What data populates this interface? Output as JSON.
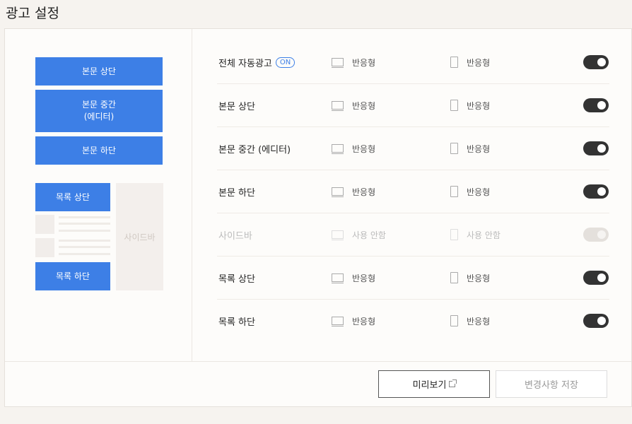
{
  "page": {
    "title": "광고 설정"
  },
  "preview": {
    "top": "본문 상단",
    "middle_line1": "본문 중간",
    "middle_line2": "(에디터)",
    "bottom": "본문 하단",
    "list_top": "목록 상단",
    "list_bottom": "목록 하단",
    "sidebar": "사이드바"
  },
  "rows": [
    {
      "label": "전체 자동광고",
      "badge": "ON",
      "pc": "반응형",
      "mobile": "반응형",
      "enabled": true
    },
    {
      "label": "본문 상단",
      "pc": "반응형",
      "mobile": "반응형",
      "enabled": true
    },
    {
      "label": "본문 중간 (에디터)",
      "pc": "반응형",
      "mobile": "반응형",
      "enabled": true
    },
    {
      "label": "본문 하단",
      "pc": "반응형",
      "mobile": "반응형",
      "enabled": true
    },
    {
      "label": "사이드바",
      "pc": "사용 안함",
      "mobile": "사용 안함",
      "enabled": false
    },
    {
      "label": "목록 상단",
      "pc": "반응형",
      "mobile": "반응형",
      "enabled": true
    },
    {
      "label": "목록 하단",
      "pc": "반응형",
      "mobile": "반응형",
      "enabled": true
    }
  ],
  "footer": {
    "preview_label": "미리보기",
    "save_label": "변경사항 저장"
  },
  "colors": {
    "accent": "#3d7fe6",
    "toggle_on": "#333333",
    "toggle_off": "#e4e0dc"
  }
}
